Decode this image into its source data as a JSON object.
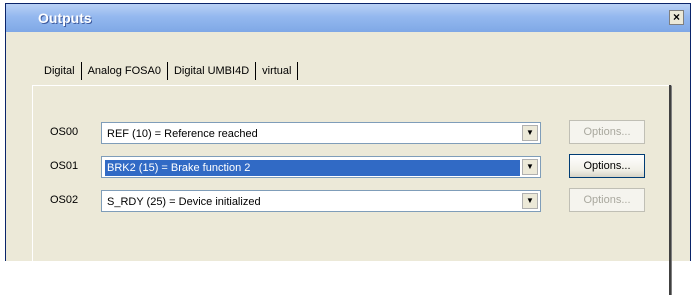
{
  "window": {
    "title": "Outputs",
    "close_glyph": "×"
  },
  "tabs": [
    {
      "label": "Digital",
      "active": true
    },
    {
      "label": "Analog FOSA0",
      "active": false
    },
    {
      "label": "Digital UMBI4D",
      "active": false
    },
    {
      "label": "virtual",
      "active": false
    }
  ],
  "outputs": [
    {
      "label": "OS00",
      "value": "REF (10) = Reference reached",
      "selected": false,
      "options_label": "Options...",
      "options_enabled": false
    },
    {
      "label": "OS01",
      "value": "BRK2 (15) = Brake function 2",
      "selected": true,
      "options_label": "Options...",
      "options_enabled": true
    },
    {
      "label": "OS02",
      "value": "S_RDY (25) = Device initialized",
      "selected": false,
      "options_label": "Options...",
      "options_enabled": false
    }
  ],
  "icons": {
    "dropdown": "chevron-down-icon",
    "close": "close-icon"
  },
  "colors": {
    "selection": "#316ac5",
    "title_text": "#ffffff",
    "dialog_bg": "#ece9d8"
  }
}
